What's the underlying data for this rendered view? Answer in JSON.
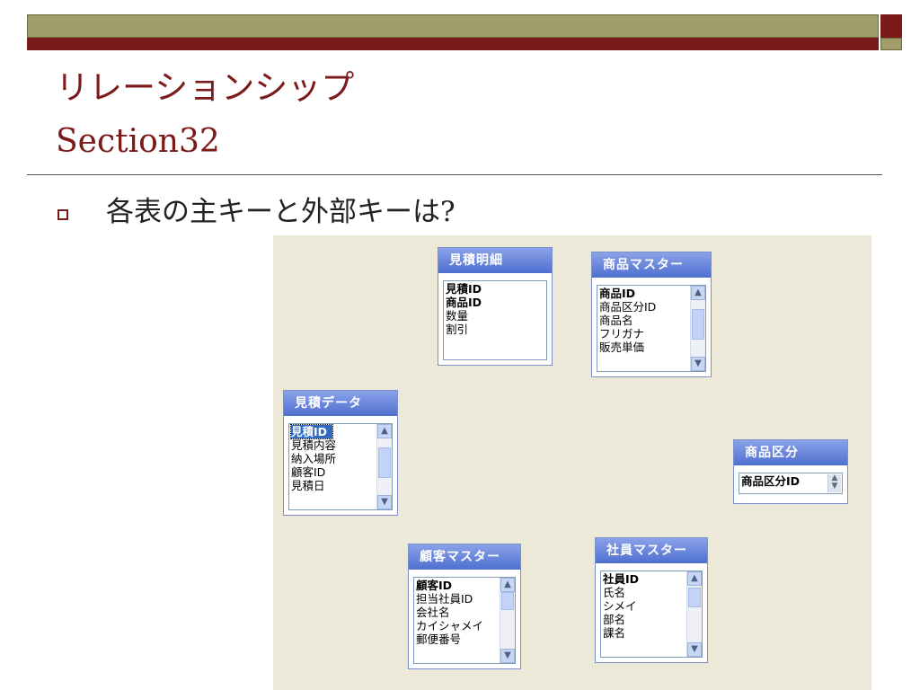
{
  "slide": {
    "title": "リレーションシップ",
    "subtitle": "Section32",
    "bullet_text": "各表の主キーと外部キーは",
    "bullet_q": "?"
  },
  "colors": {
    "accent": "#7a1a1a",
    "band": "#a09d6b",
    "canvas": "#ece9d8",
    "table_header": "#4f6fd0"
  },
  "tables": {
    "mitsumori_meisai": {
      "title": "見積明細",
      "fields": [
        "見積ID",
        "商品ID",
        "数量",
        "割引"
      ],
      "pk": [
        0,
        1
      ]
    },
    "shohin_master": {
      "title": "商品マスター",
      "fields": [
        "商品ID",
        "商品区分ID",
        "商品名",
        "フリガナ",
        "販売単価"
      ],
      "pk": [
        0
      ]
    },
    "mitsumori_data": {
      "title": "見積データ",
      "fields": [
        "見積ID",
        "見積内容",
        "納入場所",
        "顧客ID",
        "見積日"
      ],
      "pk": [
        0
      ],
      "selected": 0
    },
    "shohin_kubun": {
      "title": "商品区分",
      "fields": [
        "商品区分ID"
      ],
      "pk": [
        0
      ]
    },
    "kokyaku_master": {
      "title": "顧客マスター",
      "fields": [
        "顧客ID",
        "担当社員ID",
        "会社名",
        "カイシャメイ",
        "郵便番号"
      ],
      "pk": [
        0
      ]
    },
    "shain_master": {
      "title": "社員マスター",
      "fields": [
        "社員ID",
        "氏名",
        "シメイ",
        "部名",
        "課名"
      ],
      "pk": [
        0
      ]
    }
  },
  "icons": {
    "scroll_up": "▲",
    "scroll_down": "▼",
    "spin": "spinner-icon"
  }
}
